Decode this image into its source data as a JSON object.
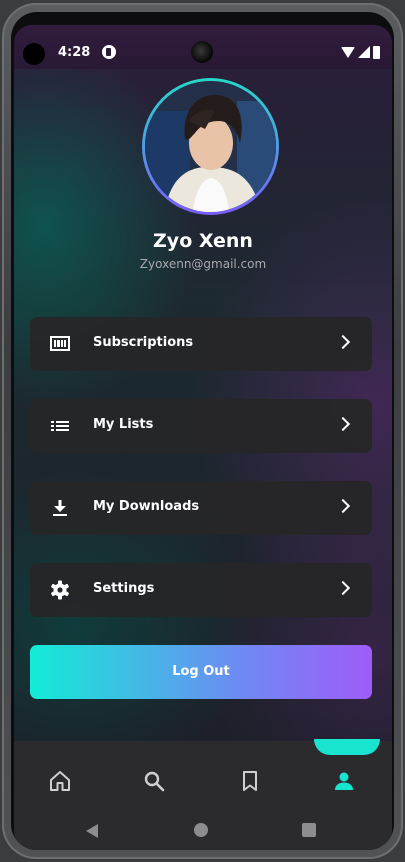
{
  "status_bar": {
    "time": "4:28"
  },
  "profile": {
    "name": "Zyo Xenn",
    "email": "Zyoxenn@gmail.com"
  },
  "menu": [
    {
      "label": "Subscriptions",
      "icon": "subscriptions-icon"
    },
    {
      "label": "My Lists",
      "icon": "list-icon"
    },
    {
      "label": "My Downloads",
      "icon": "download-icon"
    },
    {
      "label": "Settings",
      "icon": "gear-icon"
    }
  ],
  "logout_label": "Log Out",
  "bottom_nav": [
    "home-icon",
    "search-icon",
    "bookmark-icon",
    "profile-icon"
  ],
  "colors": {
    "accent_start": "#13ecd6",
    "accent_end": "#9e5cf8",
    "active_nav": "#18e4cf"
  }
}
